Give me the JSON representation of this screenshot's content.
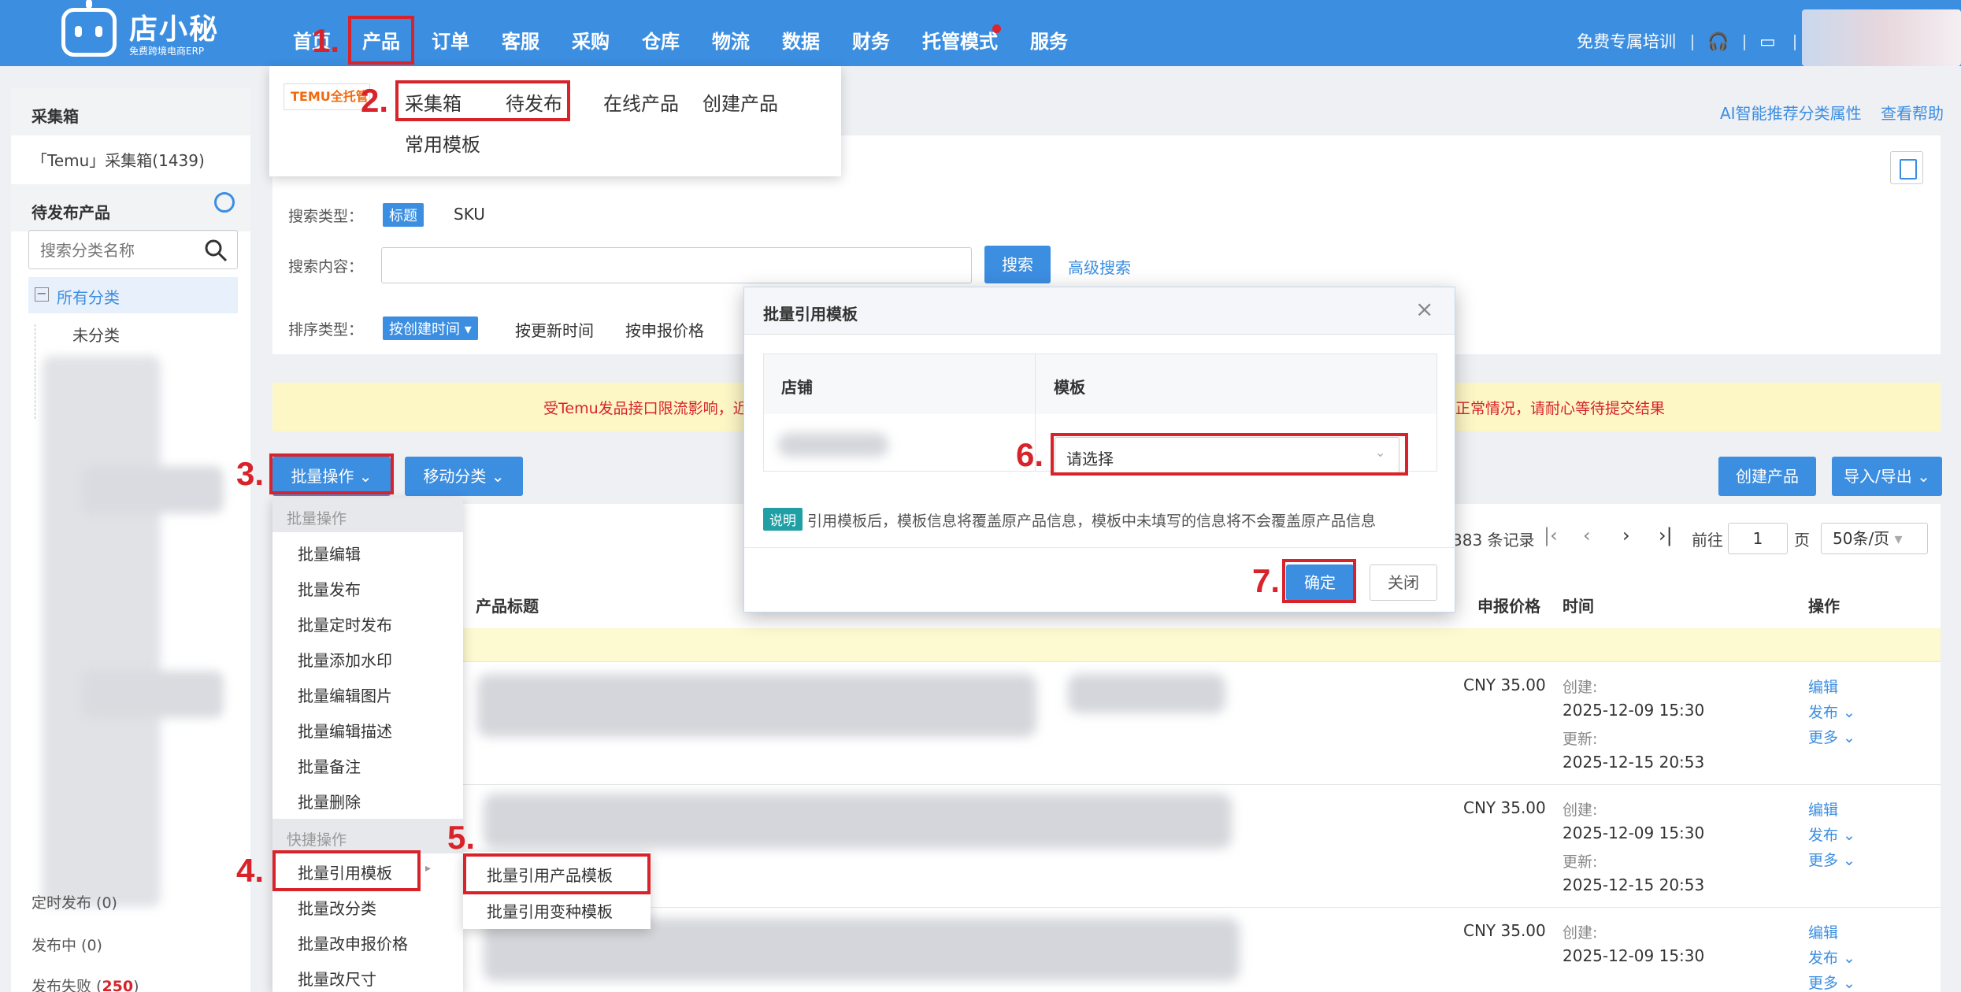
{
  "brand": {
    "name": "店小秘",
    "tagline": "免费跨境电商ERP"
  },
  "nav": {
    "items": [
      "首页",
      "产品",
      "订单",
      "客服",
      "采购",
      "仓库",
      "物流",
      "数据",
      "财务",
      "托管模式",
      "服务"
    ],
    "right_link": "免费专属培训"
  },
  "product_menu": {
    "logo_text": "TEMU全托管",
    "links": [
      "采集箱",
      "待发布",
      "在线产品",
      "创建产品",
      "常用模板"
    ]
  },
  "annotations": [
    "1.",
    "2.",
    "3.",
    "4.",
    "5.",
    "6.",
    "7."
  ],
  "sidebar": {
    "collect_head": "采集箱",
    "collect_item": "「Temu」采集箱(1439)",
    "pending_head": "待发布产品",
    "search_placeholder": "搜索分类名称",
    "all_categories": "所有分类",
    "uncategorized": "未分类",
    "scheduled": "定时发布 (0)",
    "publishing": "发布中 (0)",
    "failed_label": "发布失败 (",
    "failed_count": "250",
    "failed_close": ")"
  },
  "top_links": [
    "AI智能推荐分类属性",
    "查看帮助"
  ],
  "search": {
    "type_label": "搜索类型：",
    "type_options": [
      "标题",
      "SKU"
    ],
    "content_label": "搜索内容：",
    "search_button": "搜索",
    "advanced": "高级搜索",
    "sort_label": "排序类型：",
    "sort_options": [
      "按创建时间 ▾",
      "按更新时间",
      "按申报价格"
    ]
  },
  "notice": "受Temu发品接口限流影响，近",
  "notice_tail": "正常情况，请耐心等待提交结果",
  "toolbar": {
    "batch_button": "批量操作",
    "move_button": "移动分类",
    "create_button": "创建产品",
    "import_button": "导入/导出"
  },
  "pager": {
    "records": "383 条记录",
    "goto": "前往",
    "page": "1",
    "page_unit": "页",
    "per_page": "50条/页"
  },
  "table": {
    "headers": [
      "产品标题",
      "申报价格",
      "时间",
      "操作"
    ],
    "rows": [
      {
        "price": "CNY 35.00",
        "created_label": "创建:",
        "created": "2025-12-09 15:30",
        "updated_label": "更新:",
        "updated": "2025-12-15 20:53",
        "actions": [
          "编辑",
          "发布 ⌄",
          "更多 ⌄"
        ]
      },
      {
        "price": "CNY 35.00",
        "created_label": "创建:",
        "created": "2025-12-09 15:30",
        "updated_label": "更新:",
        "updated": "2025-12-15 20:53",
        "actions": [
          "编辑",
          "发布 ⌄",
          "更多 ⌄"
        ]
      },
      {
        "price": "CNY 35.00",
        "created_label": "创建:",
        "created": "2025-12-09 15:30",
        "updated_label": "",
        "updated": "",
        "actions": [
          "编辑",
          "发布 ⌄",
          "更多 ⌄"
        ]
      }
    ]
  },
  "batch_menu": {
    "group1": "批量操作",
    "items1": [
      "批量编辑",
      "批量发布",
      "批量定时发布",
      "批量添加水印",
      "批量编辑图片",
      "批量编辑描述",
      "批量备注",
      "批量删除"
    ],
    "group2": "快捷操作",
    "items2": [
      "批量引用模板",
      "批量改分类",
      "批量改申报价格",
      "批量改尺寸"
    ],
    "submenu": [
      "批量引用产品模板",
      "批量引用变种模板"
    ]
  },
  "modal": {
    "title": "批量引用模板",
    "col_store": "店铺",
    "col_template": "模板",
    "select_placeholder": "请选择",
    "note_tag": "说明",
    "note": "引用模板后，模板信息将覆盖原产品信息，模板中未填写的信息将不会覆盖原产品信息",
    "confirm": "确定",
    "close": "关闭"
  }
}
